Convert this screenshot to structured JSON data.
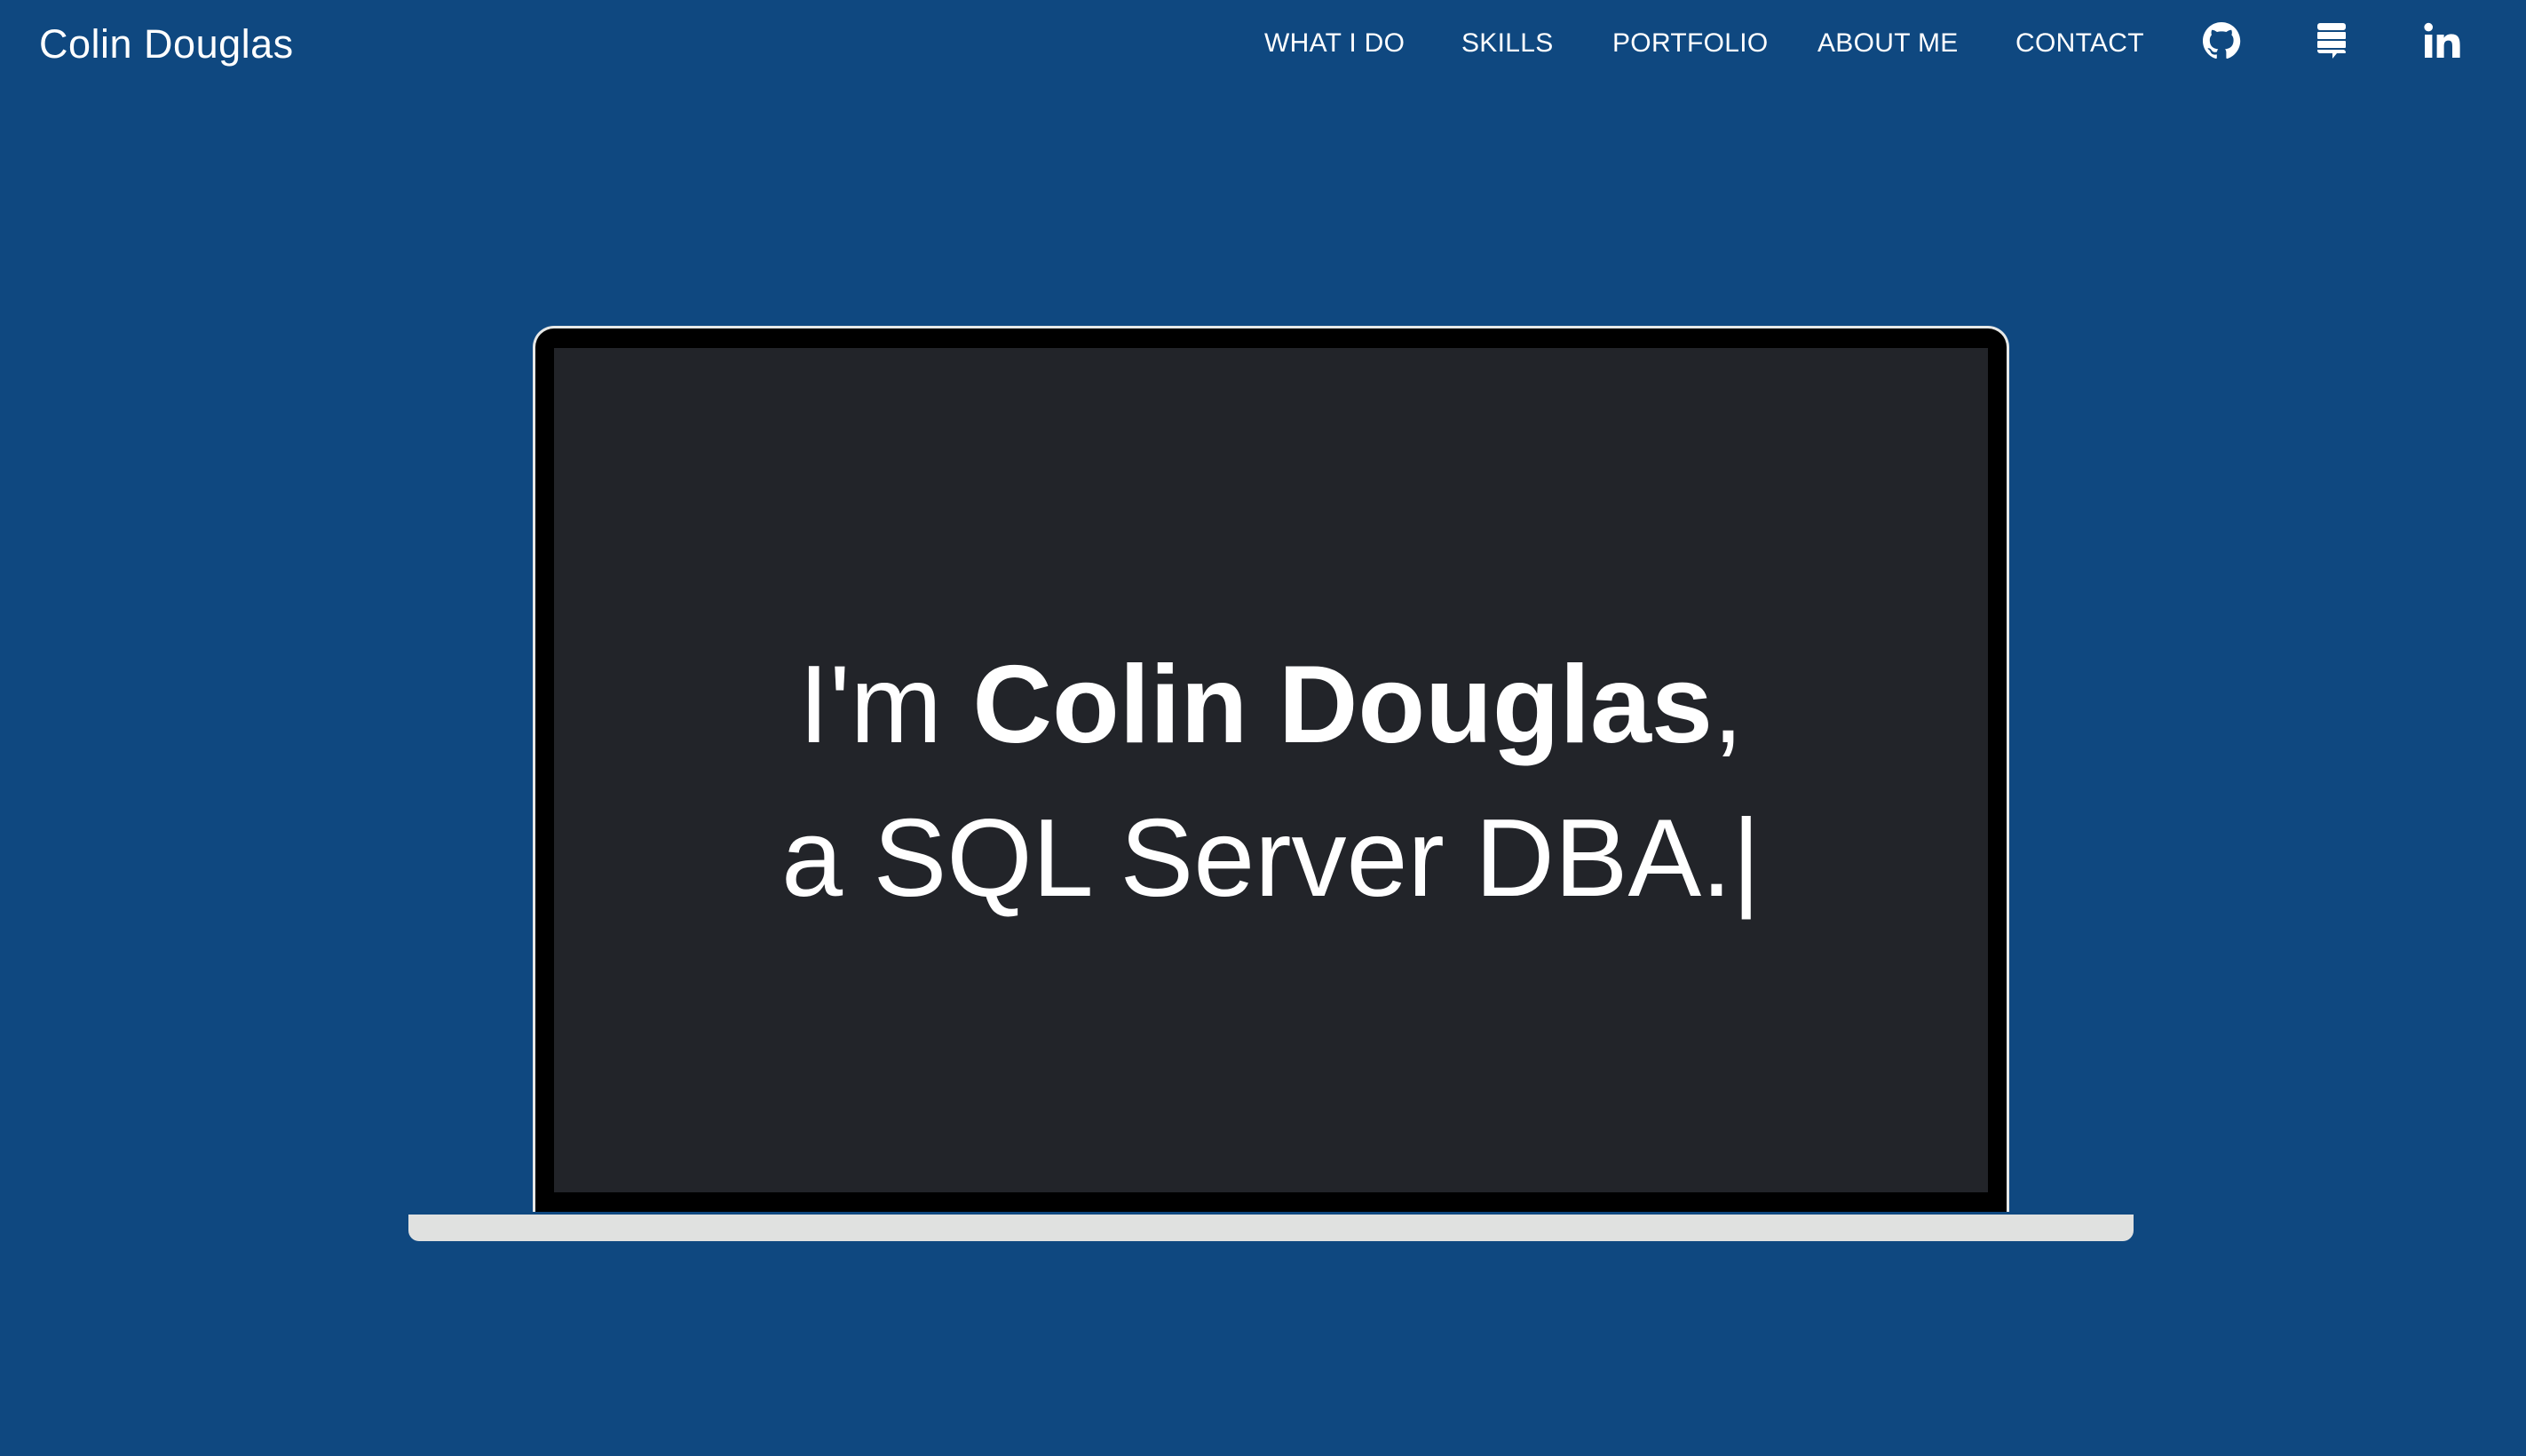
{
  "navbar": {
    "brand": "Colin Douglas",
    "links": [
      "WHAT I DO",
      "SKILLS",
      "PORTFOLIO",
      "ABOUT ME",
      "CONTACT"
    ],
    "icons": [
      "github-icon",
      "stack-overflow-icon",
      "linkedin-icon"
    ]
  },
  "hero": {
    "line1_prefix": "I'm ",
    "name": "Colin Douglas",
    "line1_suffix": ",",
    "line2": "a SQL Server DBA.",
    "cursor": "|"
  },
  "colors": {
    "background": "#0f4880",
    "screen": "#222429",
    "text": "#ffffff",
    "laptop_frame": "#000000",
    "laptop_base": "#e0e1e0"
  }
}
